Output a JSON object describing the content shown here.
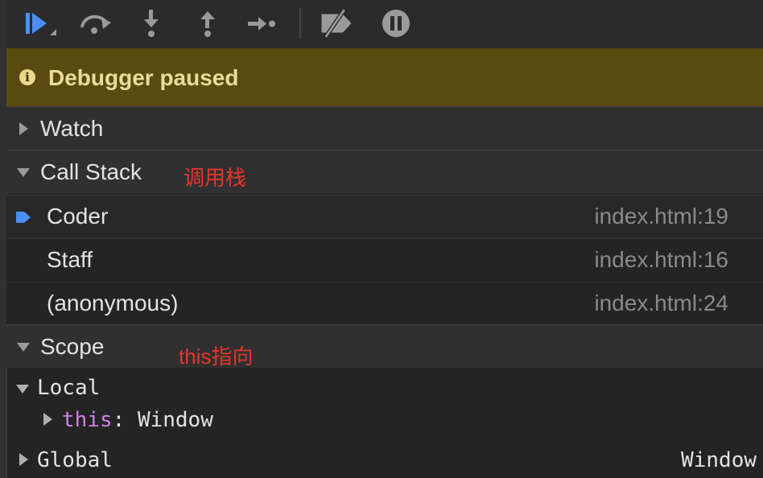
{
  "toolbar": {
    "buttons": [
      {
        "name": "resume-button",
        "icon": "resume-icon"
      },
      {
        "name": "step-over-button",
        "icon": "step-over-icon"
      },
      {
        "name": "step-into-button",
        "icon": "step-into-icon"
      },
      {
        "name": "step-out-button",
        "icon": "step-out-icon"
      },
      {
        "name": "step-button",
        "icon": "step-icon"
      },
      {
        "name": "deactivate-breakpoints-button",
        "icon": "breakpoints-off-icon"
      },
      {
        "name": "pause-on-exceptions-button",
        "icon": "pause-icon"
      }
    ],
    "accent": "#4c8ff2"
  },
  "banner": {
    "text": "Debugger paused",
    "color": "#5b4a10"
  },
  "watch": {
    "title": "Watch"
  },
  "call_stack": {
    "title": "Call Stack",
    "annotation": "调用栈",
    "frames": [
      {
        "name": "Coder",
        "location": "index.html:19",
        "selected": true
      },
      {
        "name": "Staff",
        "location": "index.html:16",
        "selected": false
      },
      {
        "name": "(anonymous)",
        "location": "index.html:24",
        "selected": false
      }
    ]
  },
  "scope": {
    "title": "Scope",
    "annotation": "this指向",
    "local": {
      "label": "Local",
      "props": [
        {
          "key": "this",
          "sep": ":",
          "value": "Window"
        }
      ]
    },
    "global": {
      "label": "Global",
      "value": "Window"
    }
  },
  "annotation_color": "#e5352a"
}
